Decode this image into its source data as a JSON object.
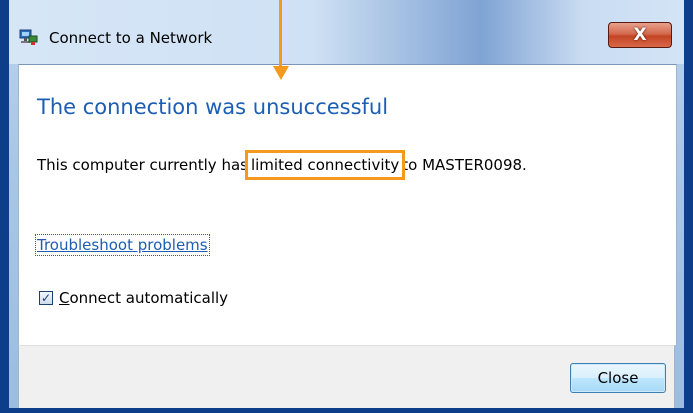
{
  "window": {
    "title": "Connect to a Network",
    "close_glyph": "X"
  },
  "content": {
    "headline": "The connection was unsuccessful",
    "message_before": "This computer currently has",
    "message_highlight": "limited connectivity",
    "message_after": "to MASTER0098.",
    "troubleshoot_link": "Troubleshoot problems",
    "auto_connect": {
      "checked": true,
      "label_first_letter": "C",
      "label_rest": "onnect automatically"
    }
  },
  "footer": {
    "close_button": "Close"
  },
  "colors": {
    "annotation": "#f39a1e",
    "link": "#1b5eb3",
    "headline": "#1b5eb3"
  },
  "icons": {
    "app": "network-icon",
    "close": "close-icon",
    "check": "checkmark-icon"
  }
}
